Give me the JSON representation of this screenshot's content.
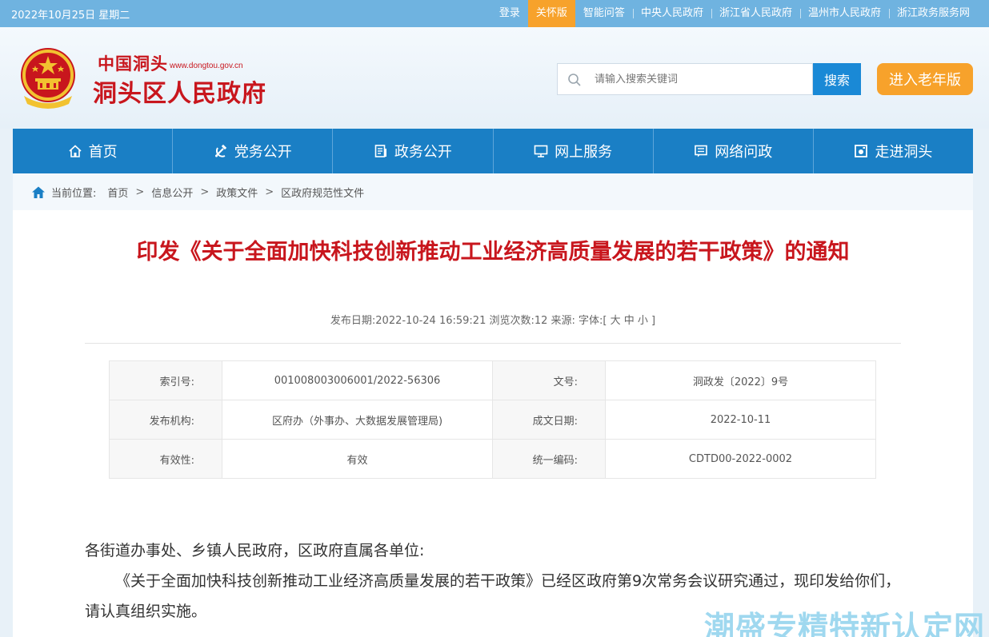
{
  "topbar": {
    "date": "2022年10月25日 星期二",
    "links": [
      "登录",
      "关怀版",
      "智能问答",
      "中央人民政府",
      "浙江省人民政府",
      "温州市人民政府",
      "浙江政务服务网"
    ]
  },
  "header": {
    "logo_small": "中国洞头",
    "logo_domain": "www.dongtou.gov.cn",
    "logo_main": "洞头区人民政府",
    "search_placeholder": "请输入搜索关键词",
    "search_button": "搜索",
    "elder_button": "进入老年版"
  },
  "nav": [
    "首页",
    "党务公开",
    "政务公开",
    "网上服务",
    "网络问政",
    "走进洞头"
  ],
  "breadcrumb": {
    "label": "当前位置:",
    "items": [
      "首页",
      "信息公开",
      "政策文件",
      "区政府规范性文件"
    ]
  },
  "article": {
    "title": "印发《关于全面加快科技创新推动工业经济高质量发展的若干政策》的通知",
    "meta": "发布日期:2022-10-24 16:59:21 浏览次数:12 来源: 字体:[ 大 中 小 ]",
    "info": {
      "index_label": "索引号:",
      "index_value": "001008003006001/2022-56306",
      "docno_label": "文号:",
      "docno_value": "洞政发〔2022〕9号",
      "issuer_label": "发布机构:",
      "issuer_value": "区府办（外事办、大数据发展管理局)",
      "date_label": "成文日期:",
      "date_value": "2022-10-11",
      "valid_label": "有效性:",
      "valid_value": "有效",
      "code_label": "统一编码:",
      "code_value": "CDTD00-2022-0002"
    },
    "para1": "各街道办事处、乡镇人民政府，区政府直属各单位:",
    "para2": "《关于全面加快科技创新推动工业经济高质量发展的若干政策》已经区政府第9次常务会议研究通过，现印发给你们，请认真组织实施。"
  },
  "watermark": "潮盛专精特新认定网",
  "colors": {
    "accent": "#1a7fc5",
    "title_red": "#c8161d",
    "care_orange": "#f7a22b"
  }
}
